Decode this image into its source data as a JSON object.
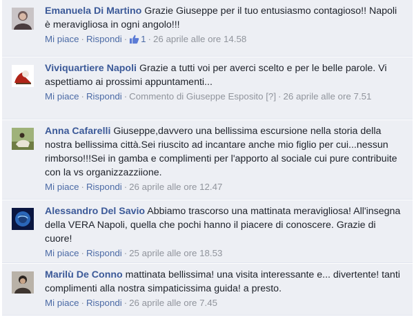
{
  "comments": [
    {
      "author": "Emanuela Di Martino",
      "text": "Grazie Giuseppe per il tuo entusiasmo contagioso!! Napoli è meravigliosa in ogni angolo!!!",
      "like_label": "Mi piace",
      "reply_label": "Rispondi",
      "like_count": "1",
      "timestamp": "26 aprile alle ore 14.58"
    },
    {
      "author": "Viviquartiere Napoli",
      "text": "Grazie a tutti voi per averci scelto e per le belle parole. Vi aspettiamo ai prossimi appuntamenti...",
      "like_label": "Mi piace",
      "reply_label": "Rispondi",
      "commented_by": "Commento di Giuseppe Esposito",
      "help": "[?]",
      "timestamp": "26 aprile alle ore 7.51"
    },
    {
      "author": "Anna Cafarelli",
      "text": "Giuseppe,davvero una bellissima escursione nella storia della nostra bellissima città.Sei riuscito ad incantare anche mio figlio per cui...nessun rimborso!!!Sei in gamba e complimenti per l'apporto al sociale cui pure contribuite con la vs organizzazziione.",
      "like_label": "Mi piace",
      "reply_label": "Rispondi",
      "timestamp": "26 aprile alle ore 12.47"
    },
    {
      "author": "Alessandro Del Savio",
      "text": "Abbiamo trascorso una mattinata meravigliosa! All'insegna della VERA Napoli, quella che pochi hanno il piacere di conoscere. Grazie di cuore!",
      "like_label": "Mi piace",
      "reply_label": "Rispondi",
      "timestamp": "25 aprile alle ore 18.53"
    },
    {
      "author": "Marilù De Conno",
      "text": "mattinata bellissima! una visita interessante e... divertente! tanti complimenti alla nostra simpaticissima guida! a presto.",
      "like_label": "Mi piace",
      "reply_label": "Rispondi",
      "timestamp": "26 aprile alle ore 7.45"
    }
  ],
  "colors": {
    "name": "#3b5998",
    "link": "#4b6aa5",
    "meta": "#90949c",
    "background": "#edeff4"
  }
}
